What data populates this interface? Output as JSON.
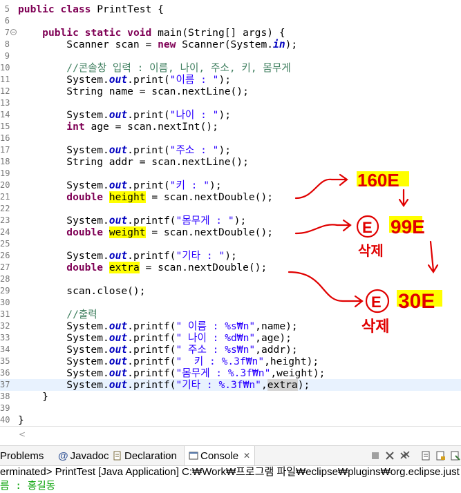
{
  "colors": {
    "keyword": "#7f0055",
    "string": "#2a00ff",
    "comment": "#3f7f5f",
    "field": "#0000c0",
    "highlight": "#ffff00",
    "annotation": "#e00000",
    "console_output": "#00a000"
  },
  "editor": {
    "lines": [
      {
        "n": "5",
        "segs": [
          {
            "t": "public class",
            "c": "kw"
          },
          {
            "t": " PrintTest {"
          }
        ]
      },
      {
        "n": "6",
        "segs": []
      },
      {
        "n": "7",
        "fold": true,
        "segs": [
          {
            "t": "    "
          },
          {
            "t": "public static void",
            "c": "kw"
          },
          {
            "t": " main(String[] args) {"
          }
        ]
      },
      {
        "n": "8",
        "segs": [
          {
            "t": "        Scanner scan = "
          },
          {
            "t": "new",
            "c": "kw"
          },
          {
            "t": " Scanner(System."
          },
          {
            "t": "in",
            "c": "fld"
          },
          {
            "t": ");"
          }
        ]
      },
      {
        "n": "9",
        "segs": []
      },
      {
        "n": "10",
        "segs": [
          {
            "t": "        "
          },
          {
            "t": "//콘솔창 입력 : 이름, 나이, 주소, 키, 몸무게",
            "c": "cm"
          }
        ]
      },
      {
        "n": "11",
        "segs": [
          {
            "t": "        System."
          },
          {
            "t": "out",
            "c": "fld"
          },
          {
            "t": ".print("
          },
          {
            "t": "\"이름 : \"",
            "c": "str"
          },
          {
            "t": ");"
          }
        ]
      },
      {
        "n": "12",
        "segs": [
          {
            "t": "        String name = scan.nextLine();"
          }
        ]
      },
      {
        "n": "13",
        "segs": []
      },
      {
        "n": "14",
        "segs": [
          {
            "t": "        System."
          },
          {
            "t": "out",
            "c": "fld"
          },
          {
            "t": ".print("
          },
          {
            "t": "\"나이 : \"",
            "c": "str"
          },
          {
            "t": ");"
          }
        ]
      },
      {
        "n": "15",
        "segs": [
          {
            "t": "        "
          },
          {
            "t": "int",
            "c": "kw"
          },
          {
            "t": " age = scan.nextInt();"
          }
        ]
      },
      {
        "n": "16",
        "segs": []
      },
      {
        "n": "17",
        "segs": [
          {
            "t": "        System."
          },
          {
            "t": "out",
            "c": "fld"
          },
          {
            "t": ".print("
          },
          {
            "t": "\"주소 : \"",
            "c": "str"
          },
          {
            "t": ");"
          }
        ]
      },
      {
        "n": "18",
        "segs": [
          {
            "t": "        String addr = scan.nextLine();"
          }
        ]
      },
      {
        "n": "19",
        "segs": []
      },
      {
        "n": "20",
        "segs": [
          {
            "t": "        System."
          },
          {
            "t": "out",
            "c": "fld"
          },
          {
            "t": ".print("
          },
          {
            "t": "\"키 : \"",
            "c": "str"
          },
          {
            "t": ");"
          }
        ]
      },
      {
        "n": "21",
        "segs": [
          {
            "t": "        "
          },
          {
            "t": "double",
            "c": "kw"
          },
          {
            "t": " "
          },
          {
            "t": "height",
            "c": "hl"
          },
          {
            "t": " = scan.nextDouble();"
          }
        ]
      },
      {
        "n": "22",
        "segs": []
      },
      {
        "n": "23",
        "segs": [
          {
            "t": "        System."
          },
          {
            "t": "out",
            "c": "fld"
          },
          {
            "t": ".printf("
          },
          {
            "t": "\"몸무게 : \"",
            "c": "str"
          },
          {
            "t": ");"
          }
        ]
      },
      {
        "n": "24",
        "segs": [
          {
            "t": "        "
          },
          {
            "t": "double",
            "c": "kw"
          },
          {
            "t": " "
          },
          {
            "t": "weight",
            "c": "hl"
          },
          {
            "t": " = scan.nextDouble();"
          }
        ]
      },
      {
        "n": "25",
        "segs": []
      },
      {
        "n": "26",
        "segs": [
          {
            "t": "        System."
          },
          {
            "t": "out",
            "c": "fld"
          },
          {
            "t": ".printf("
          },
          {
            "t": "\"기타 : \"",
            "c": "str"
          },
          {
            "t": ");"
          }
        ]
      },
      {
        "n": "27",
        "segs": [
          {
            "t": "        "
          },
          {
            "t": "double",
            "c": "kw"
          },
          {
            "t": " "
          },
          {
            "t": "extra",
            "c": "hl"
          },
          {
            "t": " = scan.nextDouble();"
          }
        ]
      },
      {
        "n": "28",
        "segs": []
      },
      {
        "n": "29",
        "segs": [
          {
            "t": "        scan.close();"
          }
        ]
      },
      {
        "n": "30",
        "segs": []
      },
      {
        "n": "31",
        "segs": [
          {
            "t": "        "
          },
          {
            "t": "//출력",
            "c": "cm"
          }
        ]
      },
      {
        "n": "32",
        "segs": [
          {
            "t": "        System."
          },
          {
            "t": "out",
            "c": "fld"
          },
          {
            "t": ".printf("
          },
          {
            "t": "\" 이름 : %s₩n\"",
            "c": "str"
          },
          {
            "t": ",name);"
          }
        ]
      },
      {
        "n": "33",
        "segs": [
          {
            "t": "        System."
          },
          {
            "t": "out",
            "c": "fld"
          },
          {
            "t": ".printf("
          },
          {
            "t": "\" 나이 : %d₩n\"",
            "c": "str"
          },
          {
            "t": ",age);"
          }
        ]
      },
      {
        "n": "34",
        "segs": [
          {
            "t": "        System."
          },
          {
            "t": "out",
            "c": "fld"
          },
          {
            "t": ".printf("
          },
          {
            "t": "\" 주소 : %s₩n\"",
            "c": "str"
          },
          {
            "t": ",addr);"
          }
        ]
      },
      {
        "n": "35",
        "segs": [
          {
            "t": "        System."
          },
          {
            "t": "out",
            "c": "fld"
          },
          {
            "t": ".printf("
          },
          {
            "t": "\"  키 : %.3f₩n\"",
            "c": "str"
          },
          {
            "t": ",height);"
          }
        ]
      },
      {
        "n": "36",
        "segs": [
          {
            "t": "        System."
          },
          {
            "t": "out",
            "c": "fld"
          },
          {
            "t": ".printf("
          },
          {
            "t": "\"몸무게 : %.3f₩n\"",
            "c": "str"
          },
          {
            "t": ",weight);"
          }
        ]
      },
      {
        "n": "37",
        "current": true,
        "segs": [
          {
            "t": "        System."
          },
          {
            "t": "out",
            "c": "fld"
          },
          {
            "t": ".printf("
          },
          {
            "t": "\"기타 : %.3f₩n\"",
            "c": "str"
          },
          {
            "t": ","
          },
          {
            "t": "extra",
            "c": "hlgray"
          },
          {
            "t": ");"
          }
        ]
      },
      {
        "n": "38",
        "segs": [
          {
            "t": "    }"
          }
        ]
      },
      {
        "n": "39",
        "segs": []
      },
      {
        "n": "40",
        "segs": [
          {
            "t": "}"
          }
        ]
      }
    ]
  },
  "annotations": {
    "a1": "160E",
    "a2": "E",
    "a3": "99E",
    "a4": "삭제",
    "a5": "E",
    "a6": "30E",
    "a7": "삭제"
  },
  "tabs": {
    "problems": "Problems",
    "javadoc": "Javadoc",
    "declaration": "Declaration",
    "console": "Console"
  },
  "status": {
    "text": "erminated> PrintTest [Java Application] C:₩Work₩프로그램 파일₩eclipse₩plugins₩org.eclipse.just"
  },
  "console": {
    "output": "름 : 홍길동"
  }
}
